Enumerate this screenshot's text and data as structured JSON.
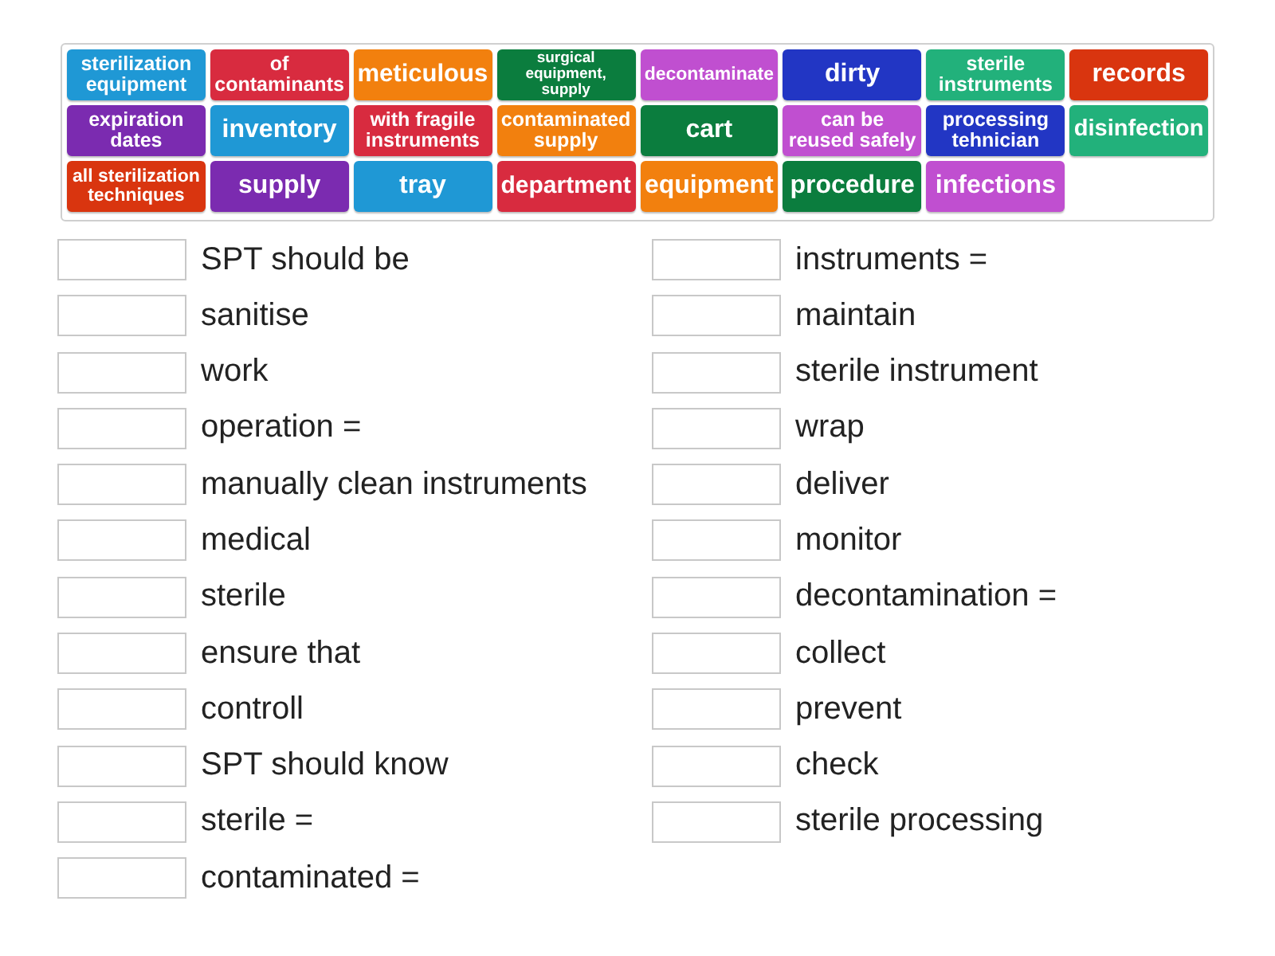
{
  "tiles": [
    {
      "text": "sterilization equipment",
      "color": "#1f98d5"
    },
    {
      "text": "of contaminants",
      "color": "#d82b3f"
    },
    {
      "text": "meticulous",
      "color": "#f2800e"
    },
    {
      "text": "surgical equipment, supply",
      "color": "#0b7d3e"
    },
    {
      "text": "decontaminate",
      "color": "#c04fd0"
    },
    {
      "text": "dirty",
      "color": "#2236c4"
    },
    {
      "text": "sterile instruments",
      "color": "#22b17b"
    },
    {
      "text": "records",
      "color": "#d9350f"
    },
    {
      "text": "expiration dates",
      "color": "#7b2bb0"
    },
    {
      "text": "inventory",
      "color": "#1f98d5"
    },
    {
      "text": "with fragile instruments",
      "color": "#d82b3f"
    },
    {
      "text": "contaminated supply",
      "color": "#f2800e"
    },
    {
      "text": "cart",
      "color": "#0b7d3e"
    },
    {
      "text": "can be reused safely",
      "color": "#c04fd0"
    },
    {
      "text": "processing tehnician",
      "color": "#2236c4"
    },
    {
      "text": "disinfection",
      "color": "#22b17b"
    },
    {
      "text": "all sterilization techniques",
      "color": "#d9350f"
    },
    {
      "text": "supply",
      "color": "#7b2bb0"
    },
    {
      "text": "tray",
      "color": "#1f98d5"
    },
    {
      "text": "department",
      "color": "#d82b3f"
    },
    {
      "text": "equipment",
      "color": "#f2800e"
    },
    {
      "text": "procedure",
      "color": "#0b7d3e"
    },
    {
      "text": "infections",
      "color": "#c04fd0"
    }
  ],
  "columns": [
    {
      "items": [
        {
          "label": "SPT should be"
        },
        {
          "label": "sanitise"
        },
        {
          "label": "work"
        },
        {
          "label": "operation ="
        },
        {
          "label": "manually clean instruments"
        },
        {
          "label": "medical"
        },
        {
          "label": "sterile"
        },
        {
          "label": "ensure that"
        },
        {
          "label": "controll"
        },
        {
          "label": "SPT should know"
        },
        {
          "label": "sterile ="
        },
        {
          "label": "contaminated ="
        }
      ]
    },
    {
      "items": [
        {
          "label": "instruments ="
        },
        {
          "label": "maintain"
        },
        {
          "label": "sterile instrument"
        },
        {
          "label": "wrap"
        },
        {
          "label": "deliver"
        },
        {
          "label": "monitor"
        },
        {
          "label": "decontamination ="
        },
        {
          "label": "collect"
        },
        {
          "label": "prevent"
        },
        {
          "label": "check"
        },
        {
          "label": "sterile processing"
        }
      ]
    }
  ]
}
